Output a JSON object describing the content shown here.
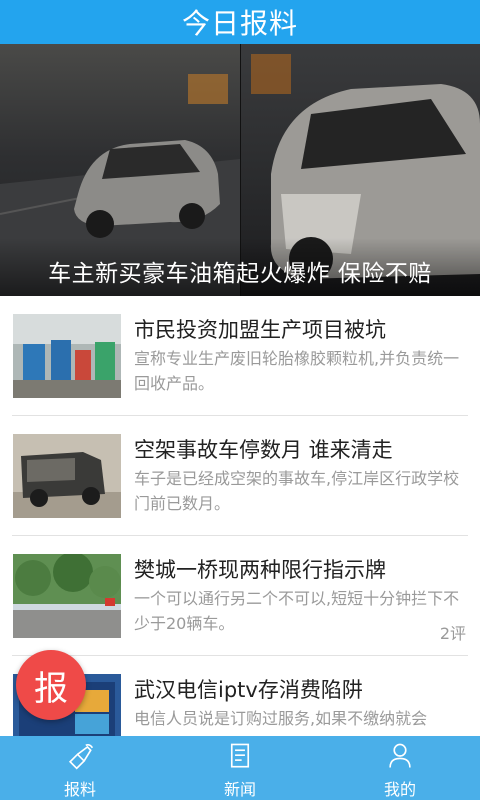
{
  "header": {
    "title": "今日报料"
  },
  "hero": {
    "caption": "车主新买豪车油箱起火爆炸 保险不赔"
  },
  "news": [
    {
      "title": "市民投资加盟生产项目被坑",
      "summary": "宣称专业生产废旧轮胎橡胶颗粒机,并负责统一回收产品。",
      "comments": ""
    },
    {
      "title": "空架事故车停数月 谁来清走",
      "summary": "车子是已经成空架的事故车,停江岸区行政学校门前已数月。",
      "comments": ""
    },
    {
      "title": "樊城一桥现两种限行指示牌",
      "summary": "一个可以通行另二个不可以,短短十分钟拦下不少于20辆车。",
      "comments": "2评"
    },
    {
      "title": "武汉电信iptv存消费陷阱",
      "summary": "电信人员说是订购过服务,如果不缴纳就会",
      "comments": ""
    }
  ],
  "fab": {
    "label": "报"
  },
  "tabs": [
    {
      "label": "报料",
      "icon": "megaphone-icon"
    },
    {
      "label": "新闻",
      "icon": "document-icon"
    },
    {
      "label": "我的",
      "icon": "person-icon"
    }
  ],
  "colors": {
    "header": "#23a4ee",
    "tabbar": "#4aafe9",
    "fab": "#ef4a48"
  }
}
